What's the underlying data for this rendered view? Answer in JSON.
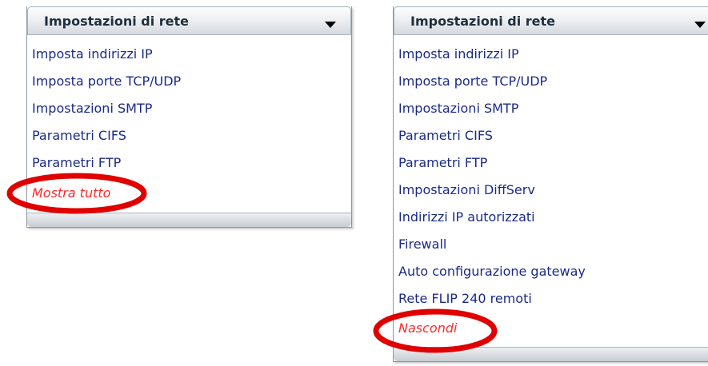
{
  "left_panel": {
    "title": "Impostazioni di rete",
    "items": [
      {
        "label": "Imposta indirizzi IP"
      },
      {
        "label": "Imposta porte TCP/UDP"
      },
      {
        "label": "Impostazioni SMTP"
      },
      {
        "label": "Parametri CIFS"
      },
      {
        "label": "Parametri FTP"
      }
    ],
    "toggle_label": "Mostra tutto"
  },
  "right_panel": {
    "title": "Impostazioni di rete",
    "items": [
      {
        "label": "Imposta indirizzi IP"
      },
      {
        "label": "Imposta porte TCP/UDP"
      },
      {
        "label": "Impostazioni SMTP"
      },
      {
        "label": "Parametri CIFS"
      },
      {
        "label": "Parametri FTP"
      },
      {
        "label": "Impostazioni DiffServ"
      },
      {
        "label": "Indirizzi IP autorizzati"
      },
      {
        "label": "Firewall"
      },
      {
        "label": "Auto configurazione gateway"
      },
      {
        "label": "Rete FLIP 240 remoti"
      }
    ],
    "toggle_label": "Nascondi"
  },
  "colors": {
    "link": "#1b2a86",
    "toggle_link": "#ff2a2a",
    "highlight": "#e00000",
    "title": "#1f2f3d"
  },
  "icons": {
    "dropdown": "triangle-down-icon"
  }
}
